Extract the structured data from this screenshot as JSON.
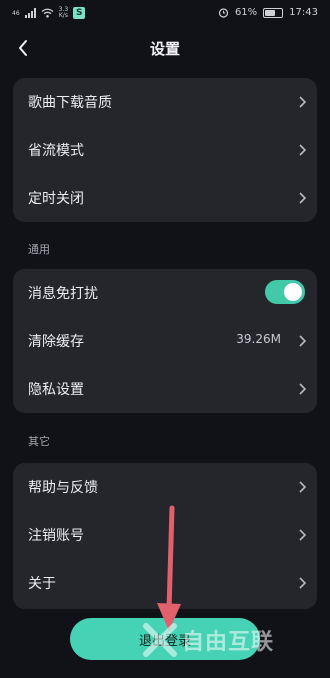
{
  "status_bar": {
    "signal_label": "46",
    "network_speed_top": "3.3",
    "network_speed_bottom": "K/s",
    "app_badge": "S",
    "battery": "61%",
    "battery_level": 0.61,
    "time": "17:43"
  },
  "nav": {
    "title": "设置"
  },
  "groups": [
    {
      "header": "",
      "items": [
        {
          "label": "歌曲下载音质"
        },
        {
          "label": "省流模式"
        },
        {
          "label": "定时关闭"
        }
      ]
    },
    {
      "header": "通用",
      "items": [
        {
          "label": "消息免打扰",
          "toggle_on": true
        },
        {
          "label": "清除缓存",
          "value": "39.26M"
        },
        {
          "label": "隐私设置"
        }
      ]
    },
    {
      "header": "其它",
      "items": [
        {
          "label": "帮助与反馈"
        },
        {
          "label": "注销账号"
        },
        {
          "label": "关于"
        }
      ]
    }
  ],
  "logout": {
    "label": "退出登录"
  },
  "watermark": {
    "text": "自由互联"
  },
  "colors": {
    "background": "#111217",
    "card": "#25262c",
    "accent": "#46d2b4",
    "arrow": "#e0606b"
  }
}
